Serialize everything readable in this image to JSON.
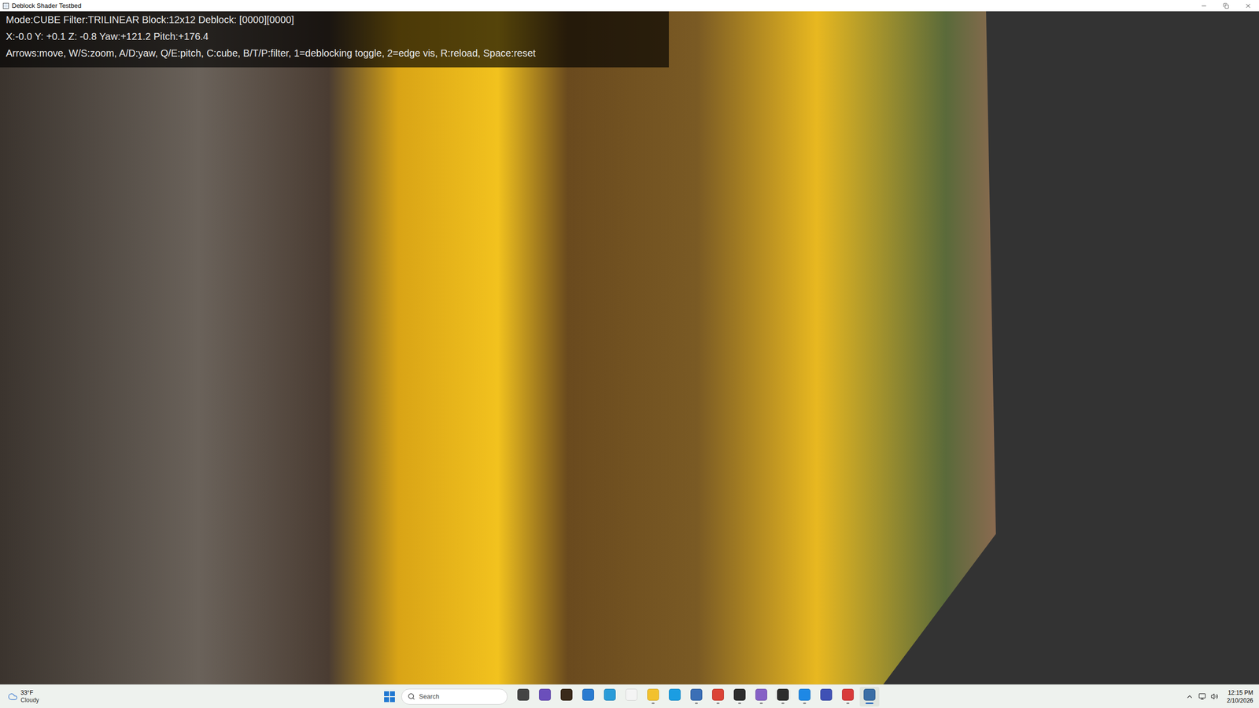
{
  "window": {
    "title": "Deblock Shader Testbed"
  },
  "hud": {
    "lines": [
      "Mode:CUBE Filter:TRILINEAR Block:12x12 Deblock: [0000][0000]",
      "X:-0.0 Y: +0.1 Z: -0.8 Yaw:+121.2 Pitch:+176.4",
      "Arrows:move, W/S:zoom, A/D:yaw, Q/E:pitch, C:cube, B/T/P:filter, 1=deblocking toggle, 2=edge vis, R:reload, Space:reset"
    ]
  },
  "taskbar": {
    "weather": {
      "temperature": "33°F",
      "condition": "Cloudy"
    },
    "search": {
      "placeholder": "Search"
    },
    "apps": [
      {
        "running": false,
        "selected": false,
        "color": "#444444"
      },
      {
        "running": false,
        "selected": false,
        "color": "#6b4fbb"
      },
      {
        "running": false,
        "selected": false,
        "color": "#3a2a1a"
      },
      {
        "running": false,
        "selected": false,
        "color": "#2a7bd0"
      },
      {
        "running": false,
        "selected": false,
        "color": "#2a9bd8"
      },
      {
        "running": false,
        "selected": false,
        "color": "#f4f4f4"
      },
      {
        "running": true,
        "selected": false,
        "color": "#f2c12e"
      },
      {
        "running": false,
        "selected": false,
        "color": "#1b9de2"
      },
      {
        "running": true,
        "selected": false,
        "color": "#3b6fb6"
      },
      {
        "running": true,
        "selected": false,
        "color": "#db4437"
      },
      {
        "running": true,
        "selected": false,
        "color": "#2d2d2d"
      },
      {
        "running": true,
        "selected": false,
        "color": "#8661c5"
      },
      {
        "running": true,
        "selected": false,
        "color": "#2d2d2d"
      },
      {
        "running": true,
        "selected": false,
        "color": "#1e88e5"
      },
      {
        "running": false,
        "selected": false,
        "color": "#3f51b5"
      },
      {
        "running": true,
        "selected": false,
        "color": "#d83b3b"
      },
      {
        "running": true,
        "selected": true,
        "color": "#3a6ea5"
      }
    ],
    "clock": {
      "time": "12:15 PM",
      "date": "2/10/2026"
    }
  }
}
